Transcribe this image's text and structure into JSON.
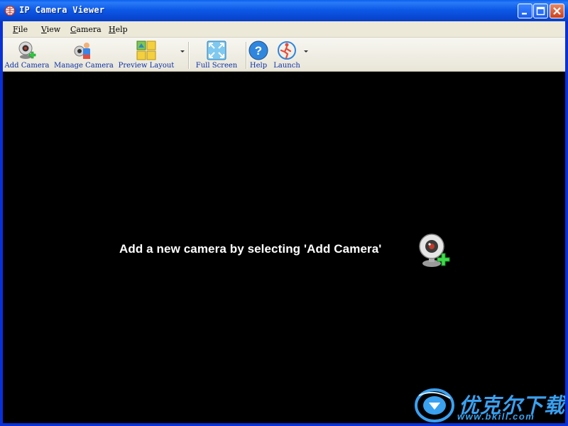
{
  "window": {
    "title": "IP Camera Viewer"
  },
  "menu": [
    {
      "label": "File",
      "mnemonic": "F",
      "rest": "ile"
    },
    {
      "label": "View",
      "mnemonic": "V",
      "rest": "iew"
    },
    {
      "label": "Camera",
      "mnemonic": "C",
      "rest": "amera"
    },
    {
      "label": "Help",
      "mnemonic": "H",
      "rest": "elp"
    }
  ],
  "toolbar": {
    "add_camera": "Add Camera",
    "manage_camera": "Manage Camera",
    "preview_layout": "Preview Layout",
    "full_screen": "Full Screen",
    "help": "Help",
    "launch": "Launch"
  },
  "content": {
    "empty_message": "Add a new camera by selecting 'Add Camera'"
  },
  "watermark": {
    "brand": "优克尔下载",
    "url": "www.bkill.com"
  },
  "colors": {
    "titlebar": "#0a5fef",
    "content_bg": "#000000",
    "toolbar_label": "#0b2fa8",
    "watermark": "#3aa0f0"
  }
}
